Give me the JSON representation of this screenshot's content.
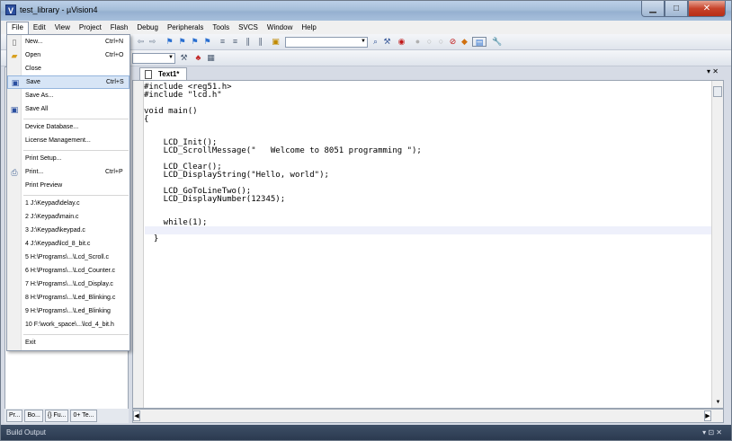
{
  "window": {
    "title": "test_library - µVision4",
    "app_icon": "V",
    "minimize": "▁",
    "maximize": "□",
    "close": "✕"
  },
  "menubar": [
    "File",
    "Edit",
    "View",
    "Project",
    "Flash",
    "Debug",
    "Peripherals",
    "Tools",
    "SVCS",
    "Window",
    "Help"
  ],
  "file_menu": [
    {
      "label": "New...",
      "shortcut": "Ctrl+N",
      "icon": "new-file-icon"
    },
    {
      "label": "Open",
      "shortcut": "Ctrl+O",
      "icon": "open-folder-icon"
    },
    {
      "label": "Close",
      "shortcut": "",
      "icon": ""
    },
    {
      "label": "Save",
      "shortcut": "Ctrl+S",
      "icon": "save-icon"
    },
    {
      "label": "Save As...",
      "shortcut": "",
      "icon": ""
    },
    {
      "label": "Save All",
      "shortcut": "",
      "icon": "save-all-icon"
    },
    {
      "label": "Device Database...",
      "shortcut": "",
      "icon": ""
    },
    {
      "label": "License Management...",
      "shortcut": "",
      "icon": ""
    },
    {
      "label": "Print Setup...",
      "shortcut": "",
      "icon": ""
    },
    {
      "label": "Print...",
      "shortcut": "Ctrl+P",
      "icon": "printer-icon"
    },
    {
      "label": "Print Preview",
      "shortcut": "",
      "icon": ""
    },
    {
      "label": "1 J:\\Keypad\\delay.c",
      "shortcut": "",
      "icon": ""
    },
    {
      "label": "2 J:\\Keypad\\main.c",
      "shortcut": "",
      "icon": ""
    },
    {
      "label": "3 J:\\Keypad\\keypad.c",
      "shortcut": "",
      "icon": ""
    },
    {
      "label": "4 J:\\Keypad\\lcd_8_bit.c",
      "shortcut": "",
      "icon": ""
    },
    {
      "label": "5 H:\\Programs\\...\\Lcd_Scroll.c",
      "shortcut": "",
      "icon": ""
    },
    {
      "label": "6 H:\\Programs\\...\\Lcd_Counter.c",
      "shortcut": "",
      "icon": ""
    },
    {
      "label": "7 H:\\Programs\\...\\Lcd_Display.c",
      "shortcut": "",
      "icon": ""
    },
    {
      "label": "8 H:\\Programs\\...\\Led_Blinking.c",
      "shortcut": "",
      "icon": ""
    },
    {
      "label": "9 H:\\Programs\\...\\Led_Blinking",
      "shortcut": "",
      "icon": ""
    },
    {
      "label": "10 F:\\work_space\\...\\lcd_4_bit.h",
      "shortcut": "",
      "icon": ""
    },
    {
      "label": "Exit",
      "shortcut": "",
      "icon": ""
    }
  ],
  "editor": {
    "tab_label": "Text1*",
    "tab_controls": "▾ ✕",
    "code": "#include <reg51.h>\n#include \"lcd.h\"\n\nvoid main()\n{\n\n\n    LCD_Init();\n    LCD_ScrollMessage(\"   Welcome to 8051 programming \");\n\n    LCD_Clear();\n    LCD_DisplayString(\"Hello, world\");\n\n    LCD_GoToLineTwo();\n    LCD_DisplayNumber(12345);\n\n\n    while(1);\n\n  }"
  },
  "panel_tabs": [
    "Pr...",
    "Bo...",
    "{} Fu...",
    "0+ Te..."
  ],
  "build_output": {
    "title": "Build Output",
    "controls": "▾ ⊡ ✕"
  }
}
